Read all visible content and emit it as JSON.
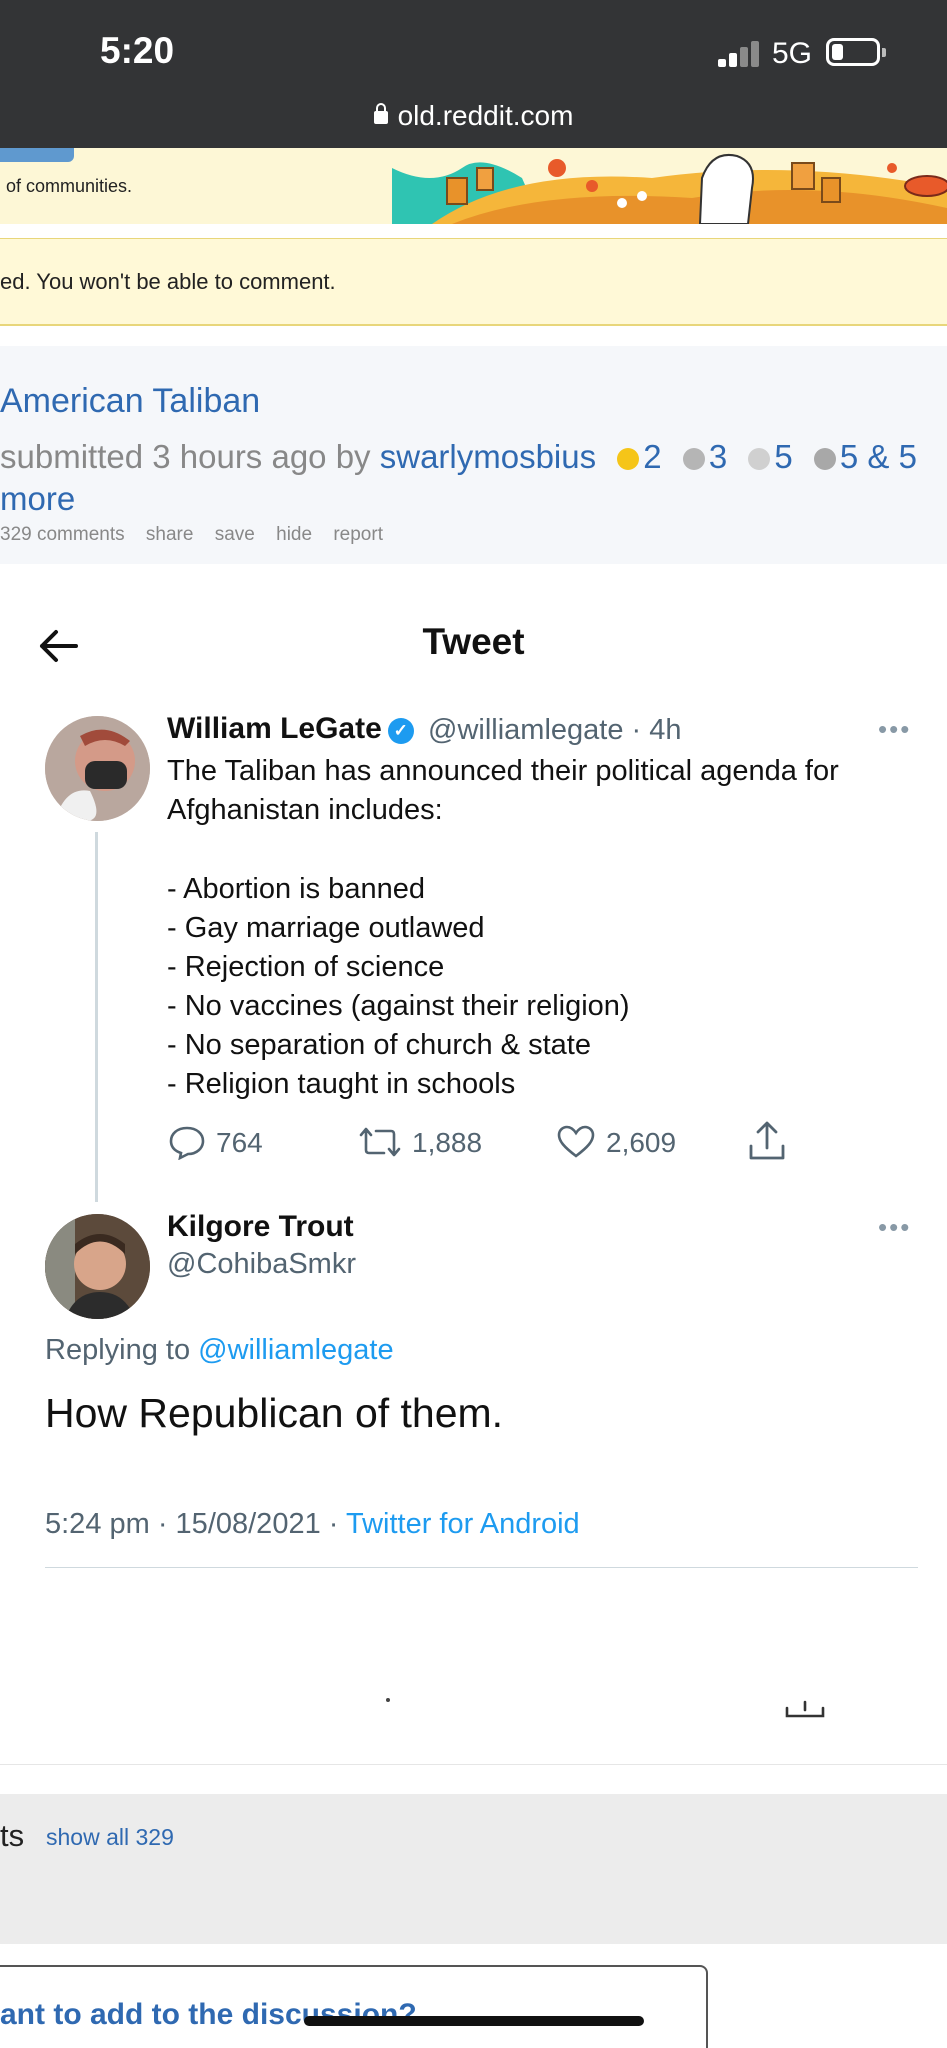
{
  "status_bar": {
    "time": "5:20",
    "network": "5G",
    "url": "old.reddit.com"
  },
  "banner": {
    "text": "of communities."
  },
  "archived_notice": {
    "text": "ed. You won't be able to comment."
  },
  "post": {
    "title": "American Taliban",
    "submitted_prefix": "submitted 3 hours ago by",
    "author": "swarlymosbius",
    "awards": [
      {
        "icon": "award-helpful-icon",
        "count": "2",
        "color": "#f5c518"
      },
      {
        "icon": "award-wholesome-icon",
        "count": "3",
        "color": "#b5b5b5"
      },
      {
        "icon": "award-laugh-icon",
        "count": "5",
        "color": "#c9c9c9"
      },
      {
        "icon": "award-silver-icon",
        "count": "5",
        "color": "#a8a8a8"
      }
    ],
    "awards_more": "& 5 more",
    "actions": [
      "329 comments",
      "share",
      "save",
      "hide",
      "report"
    ]
  },
  "tweet": {
    "header": "Tweet",
    "author_name": "William LeGate",
    "author_handle": "@williamlegate",
    "time": "· 4h",
    "text": "The Taliban has announced their political agenda for Afghanistan includes:",
    "list": [
      "- Abortion is banned",
      "- Gay marriage outlawed",
      "- Rejection of science",
      "- No vaccines (against their religion)",
      "- No separation of church & state",
      "- Religion taught in schools"
    ],
    "replies": "764",
    "retweets": "1,888",
    "likes": "2,609",
    "more": "•••"
  },
  "reply": {
    "author_name": "Kilgore Trout",
    "author_handle": "@CohibaSmkr",
    "replying_to_prefix": "Replying to",
    "replying_to": "@williamlegate",
    "text": "How Republican of them.",
    "date": "5:24 pm · 15/08/2021 ·",
    "client": "Twitter for Android",
    "more": "•••"
  },
  "comments": {
    "label": "ts",
    "show_all": "show all 329",
    "prompt": "ant to add to the discussion?"
  },
  "colors": {
    "reddit_link": "#2f69b1",
    "twitter_blue": "#1d9bf0",
    "status_bar": "#333436"
  }
}
